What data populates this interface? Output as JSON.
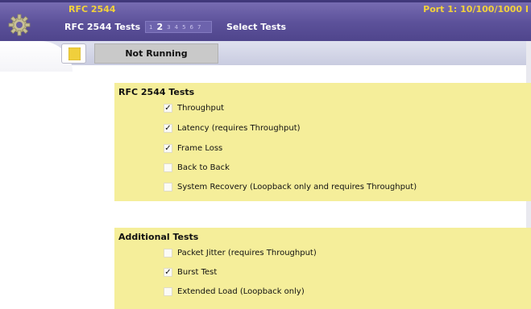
{
  "header": {
    "app_title": "RFC 2544",
    "port": "Port 1: 10/100/1000 I",
    "page_title": "RFC 2544 Tests",
    "page_tabs": [
      "1",
      "2",
      "3",
      "4",
      "5",
      "6",
      "7"
    ],
    "active_page": "2",
    "step_title": "Select Tests"
  },
  "status": {
    "text": "Not Running"
  },
  "sections": [
    {
      "title": "RFC 2544 Tests",
      "options": [
        {
          "label": "Throughput",
          "checked": true,
          "mark": "✓"
        },
        {
          "label": "Latency (requires Throughput)",
          "checked": true,
          "mark": "✓"
        },
        {
          "label": "Frame Loss",
          "checked": true,
          "mark": "✓"
        },
        {
          "label": "Back to Back",
          "checked": false,
          "mark": ""
        },
        {
          "label": "System Recovery (Loopback only and requires Throughput)",
          "checked": false,
          "mark": ""
        }
      ]
    },
    {
      "title": "Additional Tests",
      "options": [
        {
          "label": "Packet Jitter (requires Throughput)",
          "checked": false,
          "mark": ""
        },
        {
          "label": "Burst Test",
          "checked": true,
          "mark": "✓"
        },
        {
          "label": "Extended Load (Loopback only)",
          "checked": false,
          "mark": ""
        }
      ]
    }
  ],
  "colors": {
    "header_bg": "#5c519a",
    "accent_yellow": "#f3d23a",
    "section_bg": "#f5ee9a"
  },
  "icons": {
    "settings": "gear-icon",
    "bookmark": "bookmark-icon",
    "checkbox": "checkmark-icon"
  }
}
